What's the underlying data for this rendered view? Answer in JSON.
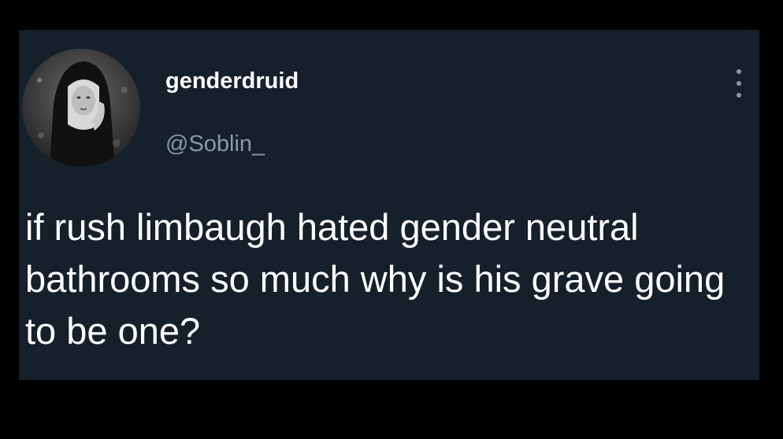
{
  "tweet": {
    "display_name": "genderdruid",
    "handle": "@Soblin_",
    "text": "if rush limbaugh hated gender neutral bathrooms so much why is his grave going to be one?",
    "avatar_icon": "profile-photo-nun-icon",
    "more_icon": "more-options-icon"
  },
  "colors": {
    "background": "#15202b",
    "frame": "#000000",
    "text": "#ffffff",
    "secondary_text": "#8b98a5"
  }
}
